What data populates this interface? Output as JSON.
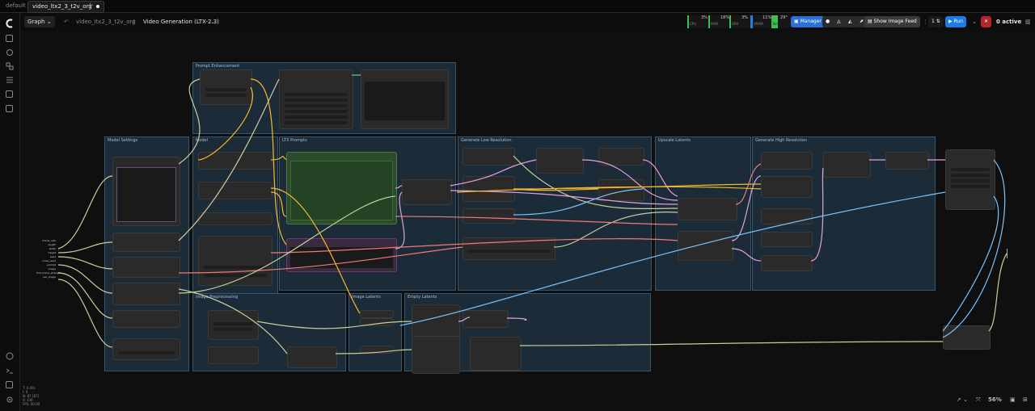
{
  "tabs": {
    "default_label": "default",
    "active_label": "video_ltx2_3_t2v_org",
    "new_tab": "+"
  },
  "toolbar": {
    "graph_label": "Graph",
    "workflow_name": "video_ltx2_3_t2v_org",
    "separator": "/",
    "subgraph_name": "Video Generation (LTX-2.3)",
    "cpu_pct": "3%",
    "cpu_label": "CPU",
    "ram_pct": "18%",
    "ram_label": "RAM",
    "gpu_pct": "3%",
    "gpu_label": "GPU",
    "vram_pct": "11%",
    "vram_label": "VRAM",
    "temp": "29°",
    "temp_label": "Temp",
    "manager_label": "Manager",
    "image_feed_label": "Show Image Feed",
    "queue_count": "1",
    "run_label": "Run",
    "active_label": "0 active"
  },
  "groups": [
    {
      "title": "Prompt Enhancement"
    },
    {
      "title": "Model Settings"
    },
    {
      "title": "Model"
    },
    {
      "title": "LTX Prompts"
    },
    {
      "title": "Generate Low Resolution"
    },
    {
      "title": "Upscale Latents"
    },
    {
      "title": "Generate High Resolution"
    },
    {
      "title": "Image Preprocessing"
    },
    {
      "title": "Image Latents"
    },
    {
      "title": "Empty Latents"
    }
  ],
  "inputs_panel": [
    "frame_rate",
    "length",
    "width",
    "height",
    "seed",
    "noise_seed",
    "prompt",
    "image",
    "first_frame_strength",
    "use_image"
  ],
  "zoom": "56%",
  "stats": [
    "T: 0.00s",
    "I: 0",
    "N: 87 [87]",
    "V: 336",
    "FPS: 60.00"
  ]
}
